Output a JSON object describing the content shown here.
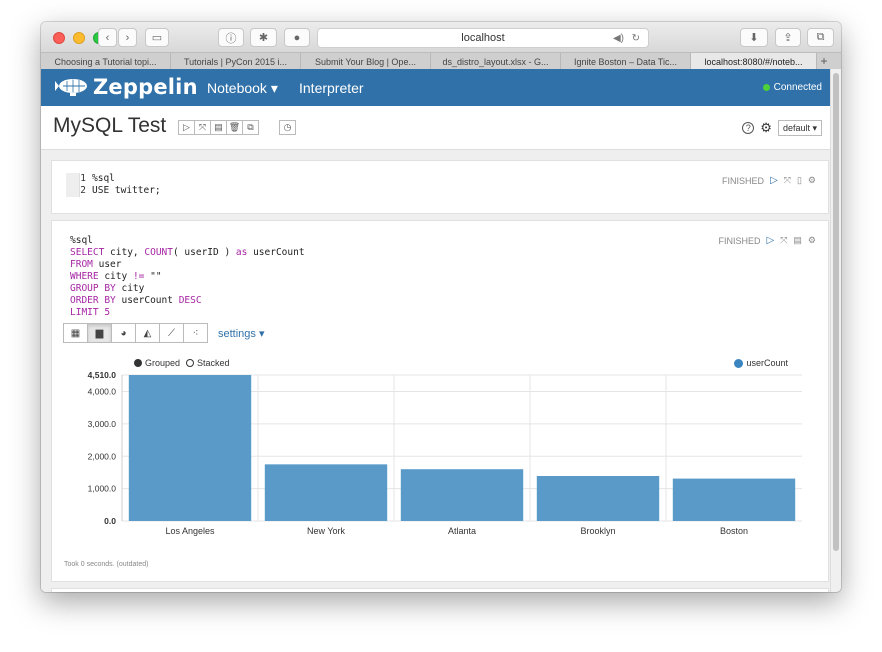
{
  "browser": {
    "address": "localhost",
    "tabs": [
      {
        "label": "Choosing a Tutorial topi...",
        "active": false
      },
      {
        "label": "Tutorials | PyCon 2015 i...",
        "active": false
      },
      {
        "label": "Submit Your Blog | Ope...",
        "active": false
      },
      {
        "label": "ds_distro_layout.xlsx - G...",
        "active": false
      },
      {
        "label": "Ignite Boston – Data Tic...",
        "active": false
      },
      {
        "label": "localhost:8080/#/noteb...",
        "active": true
      }
    ],
    "new_tab": "+"
  },
  "navbar": {
    "logo_text": "Zeppelin",
    "menu_notebook": "Notebook ▾",
    "menu_interpreter": "Interpreter",
    "status": "Connected"
  },
  "notebook": {
    "title": "MySQL Test",
    "default_label": "default ▾"
  },
  "paragraph1": {
    "status": "FINISHED",
    "lines": [
      {
        "num": "1",
        "code": "%sql"
      },
      {
        "num": "2",
        "code": "USE twitter;"
      }
    ]
  },
  "paragraph2": {
    "status": "FINISHED",
    "settings_label": "settings ▾",
    "legend_grouped": "Grouped",
    "legend_stacked": "Stacked",
    "footer": "Took 0 seconds. (outdated)"
  },
  "chart_data": {
    "type": "bar",
    "categories": [
      "Los Angeles",
      "New York",
      "Atlanta",
      "Brooklyn",
      "Boston"
    ],
    "series": [
      {
        "name": "userCount",
        "values": [
          4510,
          1750,
          1600,
          1390,
          1310
        ],
        "color": "#5a9ac9"
      }
    ],
    "yticks": [
      "0.0",
      "1,000.0",
      "2,000.0",
      "3,000.0",
      "4,000.0",
      "4,510.0"
    ],
    "ylim": [
      0,
      4510
    ],
    "legend_position": "top-right",
    "grid": true
  },
  "colors": {
    "navbar": "#3071a9",
    "accent": "#3071a9",
    "bar": "#5a9ac9"
  }
}
